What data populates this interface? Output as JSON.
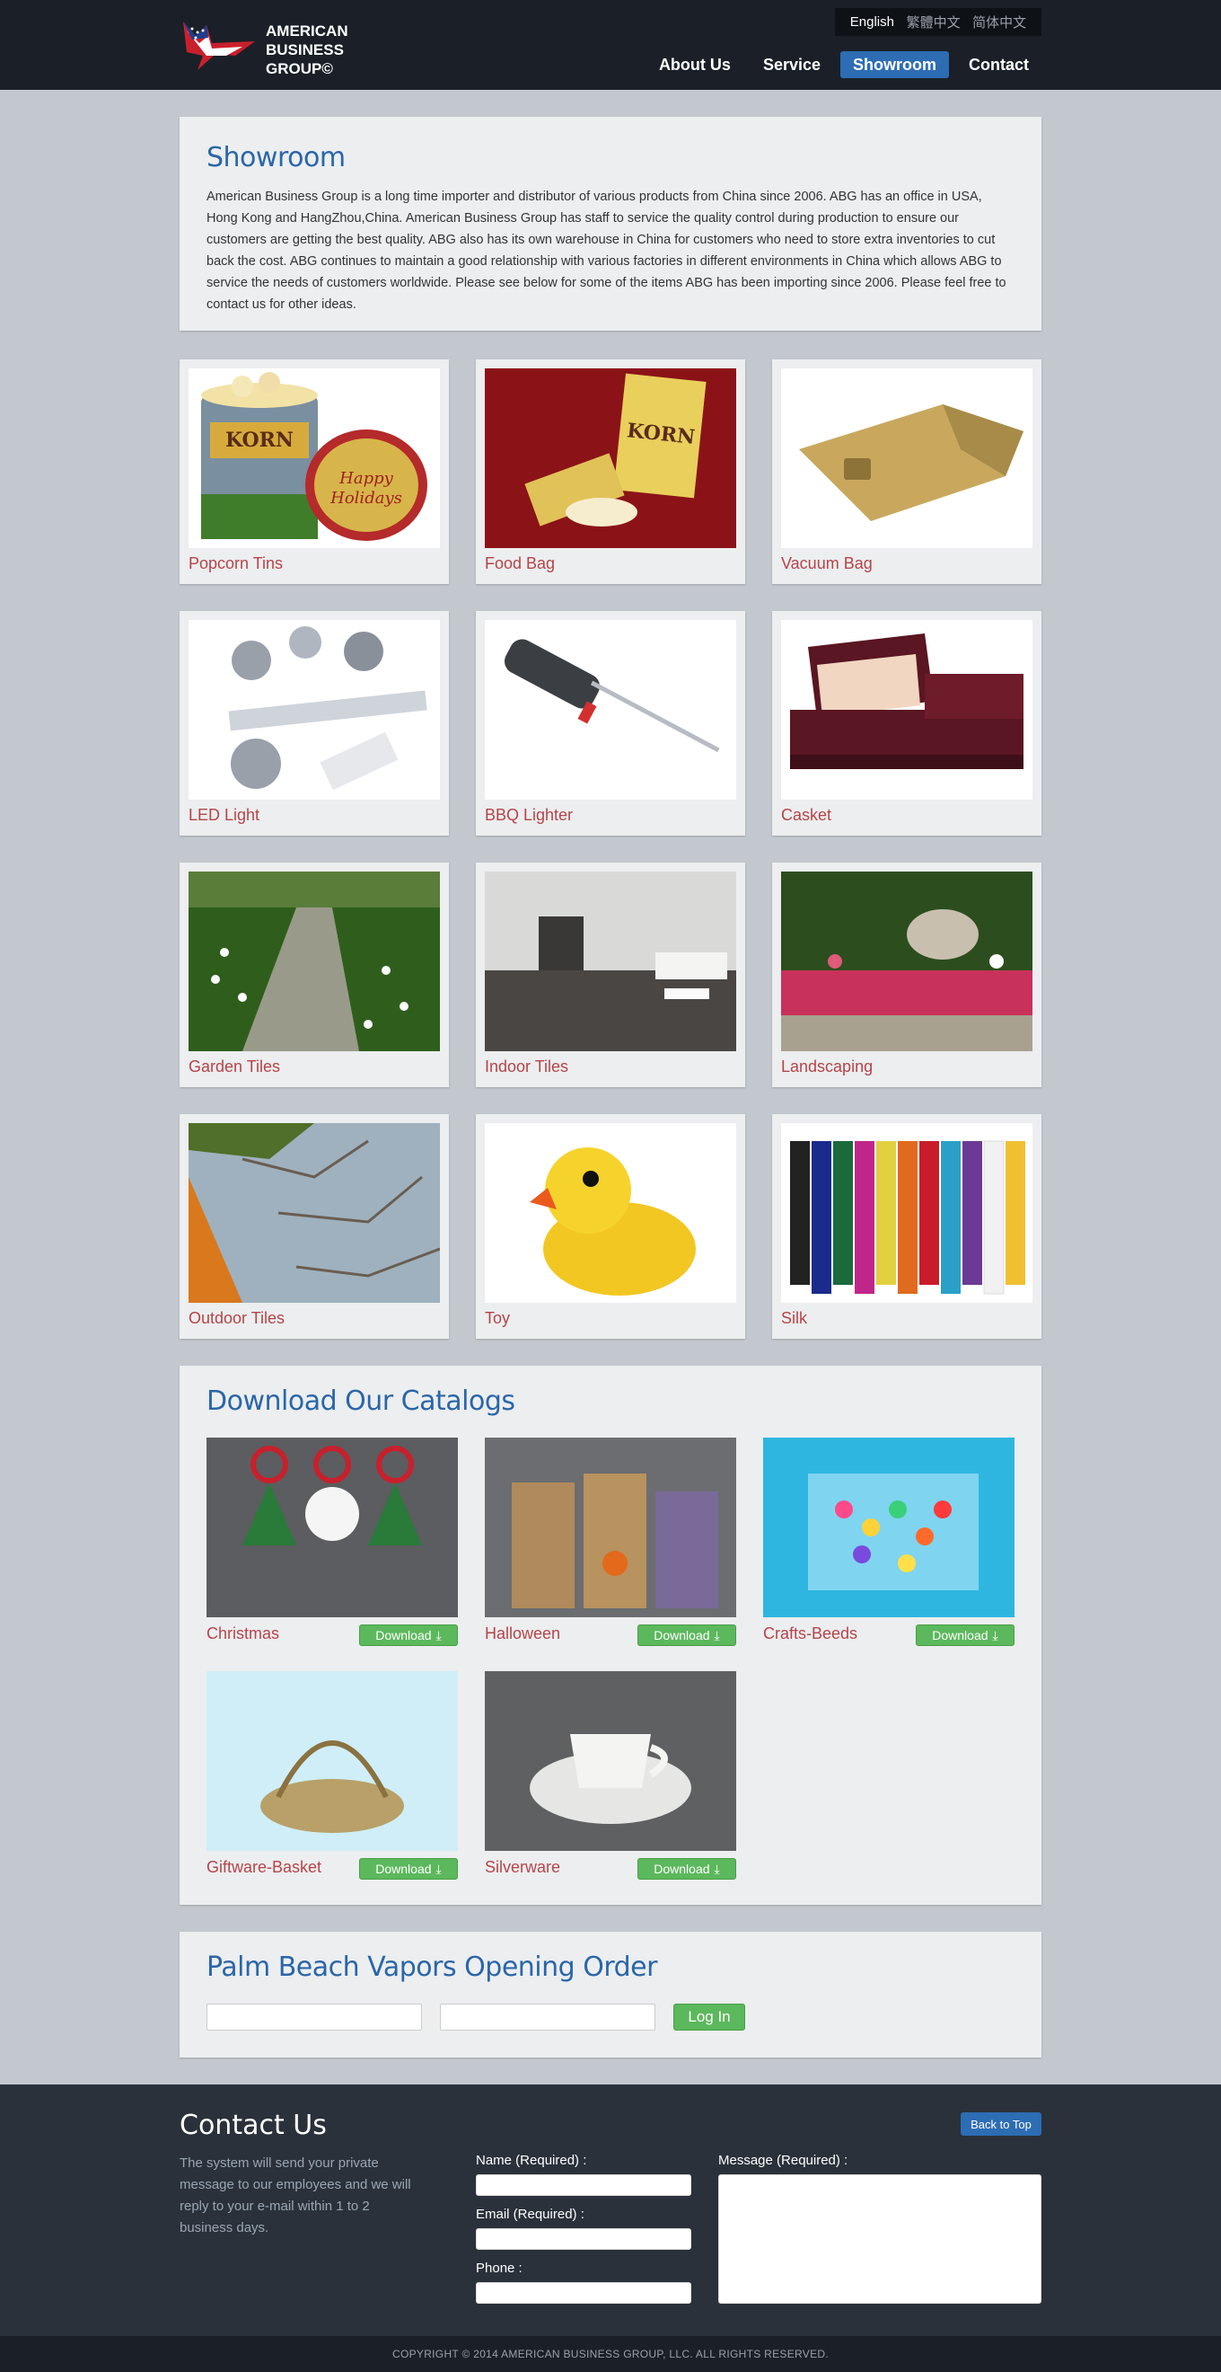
{
  "header": {
    "logo_lines": [
      "AMERICAN",
      "BUSINESS",
      "GROUP©"
    ],
    "languages": [
      "English",
      "繁體中文",
      "简体中文"
    ],
    "nav": [
      "About Us",
      "Service",
      "Showroom",
      "Contact"
    ],
    "active_nav": "Showroom"
  },
  "intro": {
    "title": "Showroom",
    "text": "American Business Group is a long time importer and distributor of various products from China since 2006. ABG has an office in USA, Hong Kong and HangZhou,China. American Business Group has staff to service the quality control during production to ensure our customers are getting the best quality. ABG also has its own warehouse in China for customers who need to store extra inventories to cut back the cost. ABG continues to maintain a good relationship with various factories in different environments in China which allows ABG to service the needs of customers worldwide. Please see below for some of the items ABG has been importing since 2006. Please feel free to contact us for other ideas."
  },
  "products": [
    {
      "label": "Popcorn Tins",
      "icon": "popcorn-tin-image"
    },
    {
      "label": "Food Bag",
      "icon": "food-bag-image"
    },
    {
      "label": "Vacuum Bag",
      "icon": "vacuum-bag-image"
    },
    {
      "label": "LED Light",
      "icon": "led-light-image"
    },
    {
      "label": "BBQ Lighter",
      "icon": "bbq-lighter-image"
    },
    {
      "label": "Casket",
      "icon": "casket-image"
    },
    {
      "label": "Garden Tiles",
      "icon": "garden-tiles-image"
    },
    {
      "label": "Indoor Tiles",
      "icon": "indoor-tiles-image"
    },
    {
      "label": "Landscaping",
      "icon": "landscaping-image"
    },
    {
      "label": "Outdoor Tiles",
      "icon": "outdoor-tiles-image"
    },
    {
      "label": "Toy",
      "icon": "rubber-duck-image"
    },
    {
      "label": "Silk",
      "icon": "silk-image"
    }
  ],
  "catalogs": {
    "title": "Download Our Catalogs",
    "download_label": "Download",
    "items": [
      {
        "label": "Christmas"
      },
      {
        "label": "Halloween"
      },
      {
        "label": "Crafts-Beeds"
      },
      {
        "label": "Giftware-Basket"
      },
      {
        "label": "Silverware"
      }
    ]
  },
  "order": {
    "title": "Palm Beach Vapors Opening Order",
    "login_label": "Log In"
  },
  "footer": {
    "title": "Contact Us",
    "back_to_top": "Back to Top",
    "description": "The system will send your private message to our employees and we will reply to your e-mail within 1 to 2 business days.",
    "name_label": "Name (Required) :",
    "email_label": "Email (Required) :",
    "phone_label": "Phone :",
    "message_label": "Message (Required) :",
    "copyright": "COPYRIGHT © 2014 AMERICAN BUSINESS GROUP, LLC. ALL RIGHTS RESERVED."
  },
  "colors": {
    "header_bg": "#1b2028",
    "page_bg": "#c3c8ce",
    "accent_blue": "#2d6db4",
    "title_blue": "#2b66a8",
    "label_red": "#b5444a",
    "download_green": "#5cb85c",
    "footer_bg": "#2a313a"
  }
}
